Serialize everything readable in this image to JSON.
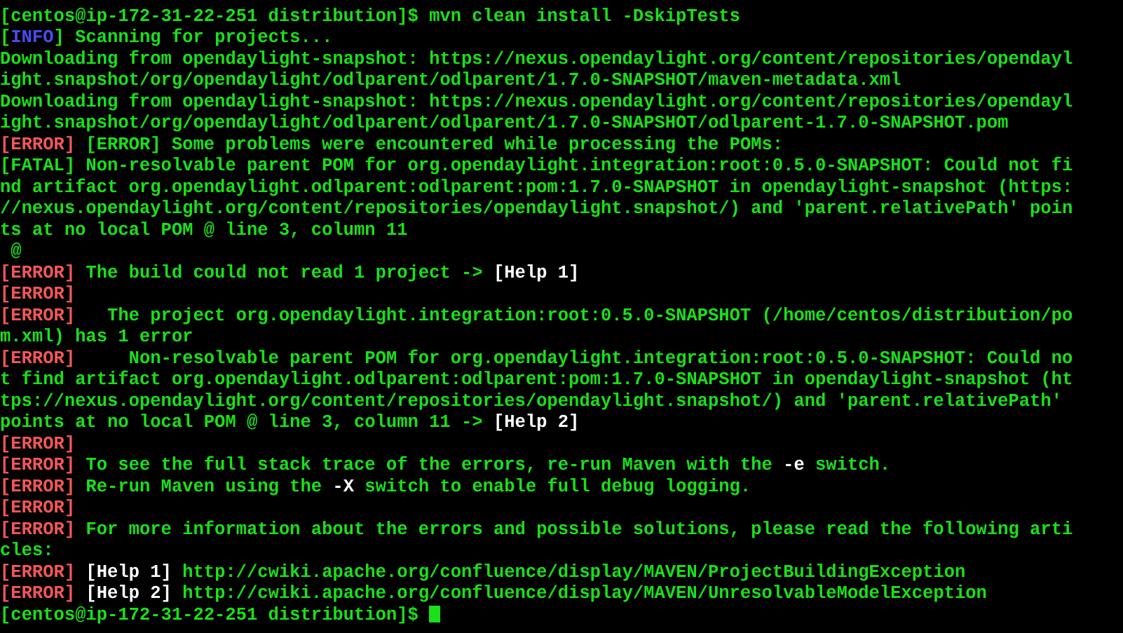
{
  "terminal": {
    "title": "centos@ip-172-31-22-251:~/distribution",
    "colors": {
      "background": "#000000",
      "green": "#19e019",
      "red": "#f25757",
      "blue": "#4b4bf0",
      "white": "#ffffff",
      "cursor": "#19e019"
    },
    "host": "ip-172-31-22-251",
    "user": "centos",
    "cwd": "distribution",
    "prompt": "[centos@ip-172-31-22-251 distribution]$ ",
    "command": "mvn clean install -DskipTests",
    "columns": 98,
    "rows": 30
  },
  "lines": [
    {
      "id": "partial-top",
      "segments": [
        {
          "text": "",
          "color": "green"
        }
      ]
    },
    {
      "id": "prompt-command",
      "segments": [
        {
          "text": "[centos@ip-172-31-22-251 distribution]$ mvn clean install -DskipTests",
          "color": "green"
        }
      ]
    },
    {
      "id": "info-scanning",
      "segments": [
        {
          "text": "[",
          "color": "green"
        },
        {
          "text": "INFO",
          "color": "blue"
        },
        {
          "text": "] Scanning for projects...",
          "color": "green"
        }
      ]
    },
    {
      "id": "downloading-1a",
      "segments": [
        {
          "text": "Downloading from opendaylight-snapshot: https://nexus.opendaylight.org/content/repositories/opendayl",
          "color": "green"
        }
      ]
    },
    {
      "id": "downloading-1b",
      "segments": [
        {
          "text": "ight.snapshot/org/opendaylight/odlparent/odlparent/1.7.0-SNAPSHOT/maven-metadata.xml",
          "color": "green"
        }
      ]
    },
    {
      "id": "downloading-2a",
      "segments": [
        {
          "text": "Downloading from opendaylight-snapshot: https://nexus.opendaylight.org/content/repositories/opendayl",
          "color": "green"
        }
      ]
    },
    {
      "id": "downloading-2b",
      "segments": [
        {
          "text": "ight.snapshot/org/opendaylight/odlparent/odlparent/1.7.0-SNAPSHOT/odlparent-1.7.0-SNAPSHOT.pom",
          "color": "green"
        }
      ]
    },
    {
      "id": "error-some-problems",
      "segments": [
        {
          "text": "[ERROR]",
          "color": "red"
        },
        {
          "text": " [ERROR] Some problems were encountered while processing the POMs:",
          "color": "green"
        }
      ]
    },
    {
      "id": "fatal-nonresolvable-a",
      "segments": [
        {
          "text": "[FATAL] Non-resolvable parent POM for org.opendaylight.integration:root:0.5.0-SNAPSHOT: Could not fi",
          "color": "green"
        }
      ]
    },
    {
      "id": "fatal-nonresolvable-b",
      "segments": [
        {
          "text": "nd artifact org.opendaylight.odlparent:odlparent:pom:1.7.0-SNAPSHOT in opendaylight-snapshot (https:",
          "color": "green"
        }
      ]
    },
    {
      "id": "fatal-nonresolvable-c",
      "segments": [
        {
          "text": "//nexus.opendaylight.org/content/repositories/opendaylight.snapshot/) and 'parent.relativePath' poin",
          "color": "green"
        }
      ]
    },
    {
      "id": "fatal-nonresolvable-d",
      "segments": [
        {
          "text": "ts at no local POM @ line 3, column 11",
          "color": "green"
        }
      ]
    },
    {
      "id": "at-sign",
      "segments": [
        {
          "text": " @",
          "color": "green"
        }
      ]
    },
    {
      "id": "error-build-could-not-read",
      "segments": [
        {
          "text": "[ERROR]",
          "color": "red"
        },
        {
          "text": " The build could not read 1 project -> ",
          "color": "green"
        },
        {
          "text": "[Help 1]",
          "color": "white"
        }
      ]
    },
    {
      "id": "error-blank-1",
      "segments": [
        {
          "text": "[ERROR]",
          "color": "red"
        }
      ]
    },
    {
      "id": "error-the-project-a",
      "segments": [
        {
          "text": "[ERROR]",
          "color": "red"
        },
        {
          "text": "   The project org.opendaylight.integration:root:0.5.0-SNAPSHOT (/home/centos/distribution/po",
          "color": "green"
        }
      ]
    },
    {
      "id": "error-the-project-b",
      "segments": [
        {
          "text": "m.xml) has 1 error",
          "color": "green"
        }
      ]
    },
    {
      "id": "error-nonresolvable-a",
      "segments": [
        {
          "text": "[ERROR]",
          "color": "red"
        },
        {
          "text": "     Non-resolvable parent POM for org.opendaylight.integration:root:0.5.0-SNAPSHOT: Could no",
          "color": "green"
        }
      ]
    },
    {
      "id": "error-nonresolvable-b",
      "segments": [
        {
          "text": "t find artifact org.opendaylight.odlparent:odlparent:pom:1.7.0-SNAPSHOT in opendaylight-snapshot (ht",
          "color": "green"
        }
      ]
    },
    {
      "id": "error-nonresolvable-c",
      "segments": [
        {
          "text": "tps://nexus.opendaylight.org/content/repositories/opendaylight.snapshot/) and 'parent.relativePath'",
          "color": "green"
        }
      ]
    },
    {
      "id": "error-nonresolvable-d",
      "segments": [
        {
          "text": "points at no local POM @ line 3, column 11 -> ",
          "color": "green"
        },
        {
          "text": "[Help 2]",
          "color": "white"
        }
      ]
    },
    {
      "id": "error-blank-2",
      "segments": [
        {
          "text": "[ERROR]",
          "color": "red"
        }
      ]
    },
    {
      "id": "error-stacktrace-hint",
      "segments": [
        {
          "text": "[ERROR]",
          "color": "red"
        },
        {
          "text": " To see the full stack trace of the errors, re-run Maven with the ",
          "color": "green"
        },
        {
          "text": "-e",
          "color": "white"
        },
        {
          "text": " switch.",
          "color": "green"
        }
      ]
    },
    {
      "id": "error-debug-hint",
      "segments": [
        {
          "text": "[ERROR]",
          "color": "red"
        },
        {
          "text": " Re-run Maven using the ",
          "color": "green"
        },
        {
          "text": "-X",
          "color": "white"
        },
        {
          "text": " switch to enable full debug logging.",
          "color": "green"
        }
      ]
    },
    {
      "id": "error-blank-3",
      "segments": [
        {
          "text": "[ERROR]",
          "color": "red"
        }
      ]
    },
    {
      "id": "error-more-info-a",
      "segments": [
        {
          "text": "[ERROR]",
          "color": "red"
        },
        {
          "text": " For more information about the errors and possible solutions, please read the following arti",
          "color": "green"
        }
      ]
    },
    {
      "id": "error-more-info-b",
      "segments": [
        {
          "text": "cles:",
          "color": "green"
        }
      ]
    },
    {
      "id": "error-help-1",
      "segments": [
        {
          "text": "[ERROR]",
          "color": "red"
        },
        {
          "text": " [Help 1]",
          "color": "white"
        },
        {
          "text": " http://cwiki.apache.org/confluence/display/MAVEN/ProjectBuildingException",
          "color": "green"
        }
      ]
    },
    {
      "id": "error-help-2",
      "segments": [
        {
          "text": "[ERROR]",
          "color": "red"
        },
        {
          "text": " [Help 2]",
          "color": "white"
        },
        {
          "text": " http://cwiki.apache.org/confluence/display/MAVEN/UnresolvableModelException",
          "color": "green"
        }
      ]
    },
    {
      "id": "final-prompt",
      "segments": [
        {
          "text": "[centos@ip-172-31-22-251 distribution]$ ",
          "color": "green"
        }
      ],
      "cursor": true
    }
  ]
}
